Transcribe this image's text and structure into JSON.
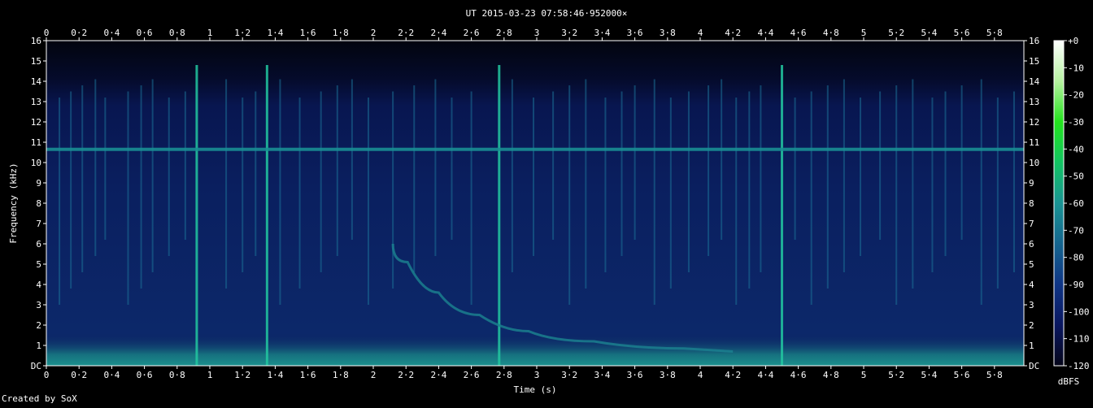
{
  "chart_data": {
    "type": "heatmap",
    "title": "UT 2015-03-23 07:58:46·952000×",
    "xlabel": "Time (s)",
    "ylabel": "Frequency (kHz)",
    "xlim": [
      0,
      5.98
    ],
    "ylim": [
      0,
      16
    ],
    "x_ticks": [
      "0",
      "0·2",
      "0·4",
      "0·6",
      "0·8",
      "1",
      "1·2",
      "1·4",
      "1·6",
      "1·8",
      "2",
      "2·2",
      "2·4",
      "2·6",
      "2·8",
      "3",
      "3·2",
      "3·4",
      "3·6",
      "3·8",
      "4",
      "4·2",
      "4·4",
      "4·6",
      "4·8",
      "5",
      "5·2",
      "5·4",
      "5·6",
      "5·8"
    ],
    "y_ticks": [
      "DC",
      "1",
      "2",
      "3",
      "4",
      "5",
      "6",
      "7",
      "8",
      "9",
      "10",
      "11",
      "12",
      "13",
      "14",
      "15",
      "16"
    ],
    "colorbar": {
      "label": "dBFS",
      "ticks": [
        "+0",
        "-10",
        "-20",
        "-30",
        "-40",
        "-50",
        "-60",
        "-70",
        "-80",
        "-90",
        "-100",
        "-110",
        "-120"
      ],
      "range": [
        -120,
        0
      ],
      "colors": [
        "#06061a",
        "#0a1760",
        "#0f3585",
        "#15658f",
        "#1a9494",
        "#12c462",
        "#23e41c",
        "#b6f2a0",
        "#ffffff"
      ]
    },
    "features": {
      "tone_band_khz": 10.65,
      "low_band_khz": [
        0,
        1.2
      ],
      "dispersive_whistler": [
        {
          "t": 2.12,
          "f": 6.0
        },
        {
          "t": 2.3,
          "f": 4.2
        },
        {
          "t": 2.5,
          "f": 3.0
        },
        {
          "t": 2.8,
          "f": 2.0
        },
        {
          "t": 3.1,
          "f": 1.4
        },
        {
          "t": 3.6,
          "f": 1.0
        },
        {
          "t": 4.2,
          "f": 0.7
        }
      ],
      "strong_sferics_s": [
        0.92,
        1.35,
        2.77,
        4.5
      ],
      "sferic_times_s": [
        0.08,
        0.15,
        0.22,
        0.3,
        0.36,
        0.5,
        0.58,
        0.65,
        0.75,
        0.85,
        0.92,
        1.1,
        1.2,
        1.28,
        1.35,
        1.43,
        1.55,
        1.68,
        1.78,
        1.87,
        1.97,
        2.12,
        2.25,
        2.38,
        2.48,
        2.6,
        2.77,
        2.85,
        2.98,
        3.1,
        3.2,
        3.3,
        3.42,
        3.52,
        3.6,
        3.72,
        3.82,
        3.93,
        4.05,
        4.13,
        4.22,
        4.3,
        4.37,
        4.5,
        4.58,
        4.68,
        4.78,
        4.88,
        4.98,
        5.1,
        5.2,
        5.3,
        5.42,
        5.5,
        5.6,
        5.72,
        5.82,
        5.92
      ]
    },
    "footer": "Created by SoX"
  }
}
